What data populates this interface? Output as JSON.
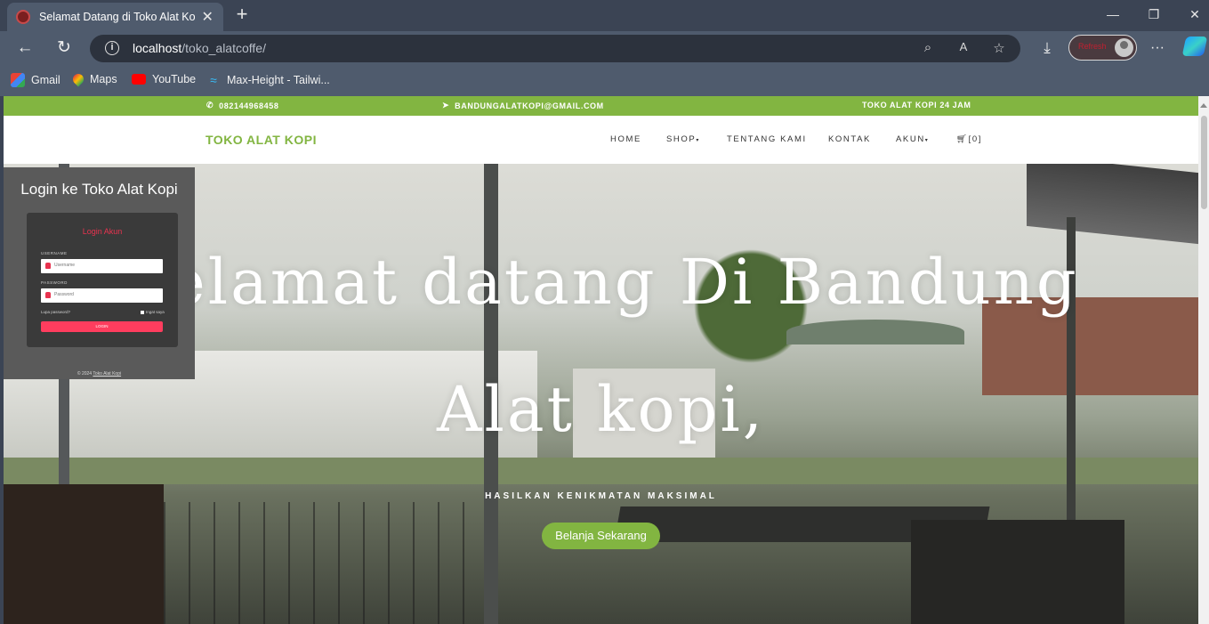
{
  "browser": {
    "tab_title": "Selamat Datang di Toko Alat Kopi",
    "url_host": "localhost",
    "url_path": "/toko_alatcoffe/",
    "profile_label": "Refresh",
    "bookmarks": [
      "Gmail",
      "Maps",
      "YouTube",
      "Max-Height - Tailwi..."
    ]
  },
  "topbar": {
    "phone": "082144968458",
    "email": "BANDUNGALATKOPI@GMAIL.COM",
    "hours": "TOKO ALAT KOPI 24 JAM",
    "color": "#82b541"
  },
  "nav": {
    "brand": "TOKO ALAT KOPI",
    "home": "HOME",
    "shop": "SHOP",
    "about": "TENTANG KAMI",
    "contact": "KONTAK",
    "account": "AKUN",
    "cart": "[0]"
  },
  "hero": {
    "title_line1": "Selamat datang Di Bandung",
    "title_line2": "Alat kopi,",
    "subtitle": "HASILKAN KENIKMATAN MAKSIMAL",
    "cta": "Belanja Sekarang"
  },
  "login": {
    "heading": "Login ke Toko Alat Kopi",
    "card_title": "Login Akun",
    "username_label": "USERNAME",
    "username_placeholder": "Username",
    "password_label": "PASSWORD",
    "password_placeholder": "Password",
    "forgot": "Lupa password?",
    "remember": "Ingat saya",
    "button": "LOGIN",
    "footer_prefix": "© 2024",
    "footer_link": "Toko Alat Kopi"
  }
}
